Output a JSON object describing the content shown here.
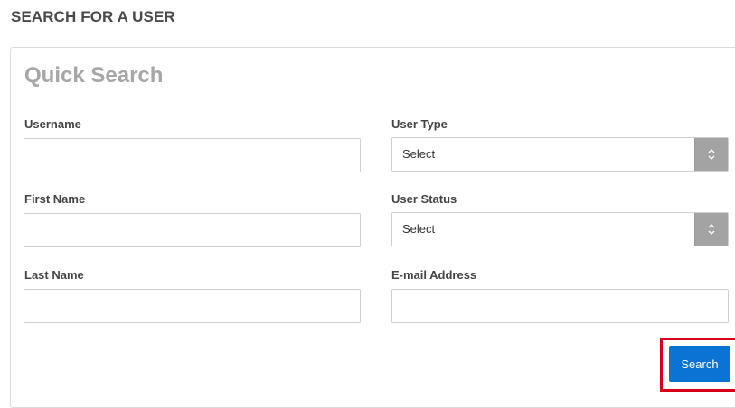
{
  "page": {
    "title": "SEARCH FOR A USER"
  },
  "quick_search": {
    "title": "Quick Search",
    "fields": {
      "username": {
        "label": "Username",
        "value": ""
      },
      "first_name": {
        "label": "First Name",
        "value": ""
      },
      "last_name": {
        "label": "Last Name",
        "value": ""
      },
      "user_type": {
        "label": "User Type",
        "selected": "Select"
      },
      "user_status": {
        "label": "User Status",
        "selected": "Select"
      },
      "email": {
        "label": "E-mail Address",
        "value": ""
      }
    },
    "search_button_label": "Search"
  },
  "colors": {
    "button": "#0b73d4",
    "highlight": "#d7001a",
    "select_arrow_bg": "#a3a3a3"
  }
}
